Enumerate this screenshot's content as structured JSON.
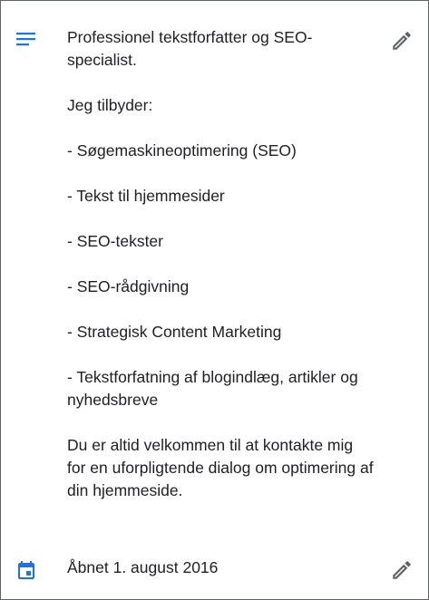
{
  "colors": {
    "accent": "#1a73e8",
    "text": "#202124",
    "icon_gray": "#5f6368",
    "border": "#5f6368"
  },
  "description": {
    "icon": "notes-icon",
    "edit_icon": "pencil-icon",
    "lines": [
      "Professionel tekstforfatter og SEO-specialist.",
      "",
      "Jeg tilbyder:",
      "",
      "- Søgemaskineoptimering (SEO)",
      "",
      "- Tekst til hjemmesider",
      "",
      "- SEO-tekster",
      "",
      "- SEO-rådgivning",
      "",
      "- Strategisk Content Marketing",
      "",
      "- Tekstforfatning af blogindlæg, artikler og nyhedsbreve",
      "",
      "Du er altid velkommen til at kontakte mig for en uforpligtende dialog om optimering af din hjemmeside."
    ]
  },
  "opened": {
    "icon": "calendar-icon",
    "edit_icon": "pencil-icon",
    "label": "Åbnet 1. august 2016"
  }
}
